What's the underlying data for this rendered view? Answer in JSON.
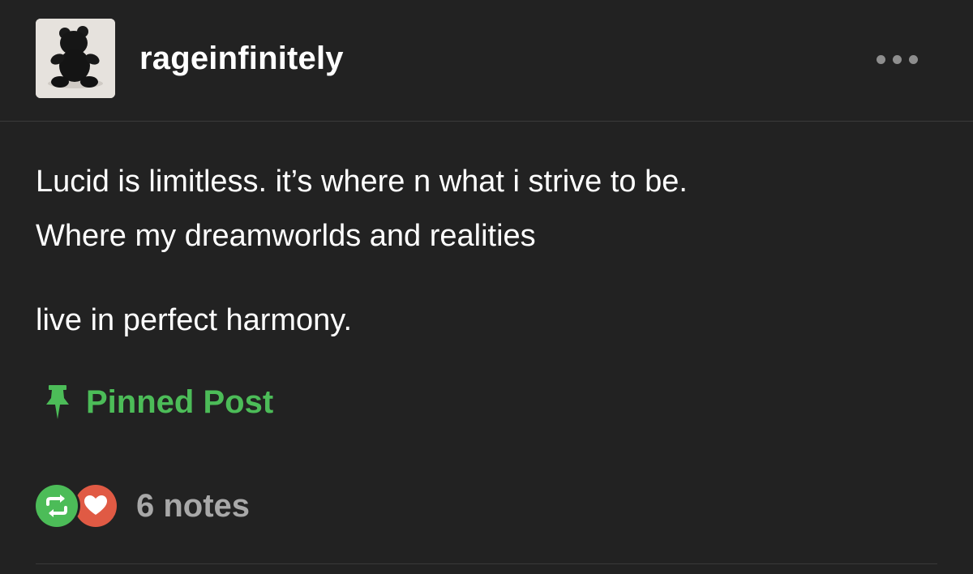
{
  "post": {
    "username": "rageinfinitely",
    "avatar_icon": "black-teddy-bear-avatar",
    "more_icon": "ellipsis-icon",
    "body_lines": [
      "Lucid is limitless. it’s where n what i strive to be.",
      "Where my dreamworlds and realities",
      "live in perfect harmony."
    ],
    "pinned_label": "Pinned Post",
    "pin_icon": "pushpin-icon",
    "notes_label": "6 notes",
    "note_icons": [
      "reblog-icon",
      "heart-icon"
    ]
  },
  "colors": {
    "background": "#222222",
    "text": "#ffffff",
    "pinned_green": "#4cbc58",
    "reblog_green": "#4cbc58",
    "like_red": "#e05a44",
    "muted_text": "#a8a8a8",
    "divider": "#3a3a3a"
  }
}
